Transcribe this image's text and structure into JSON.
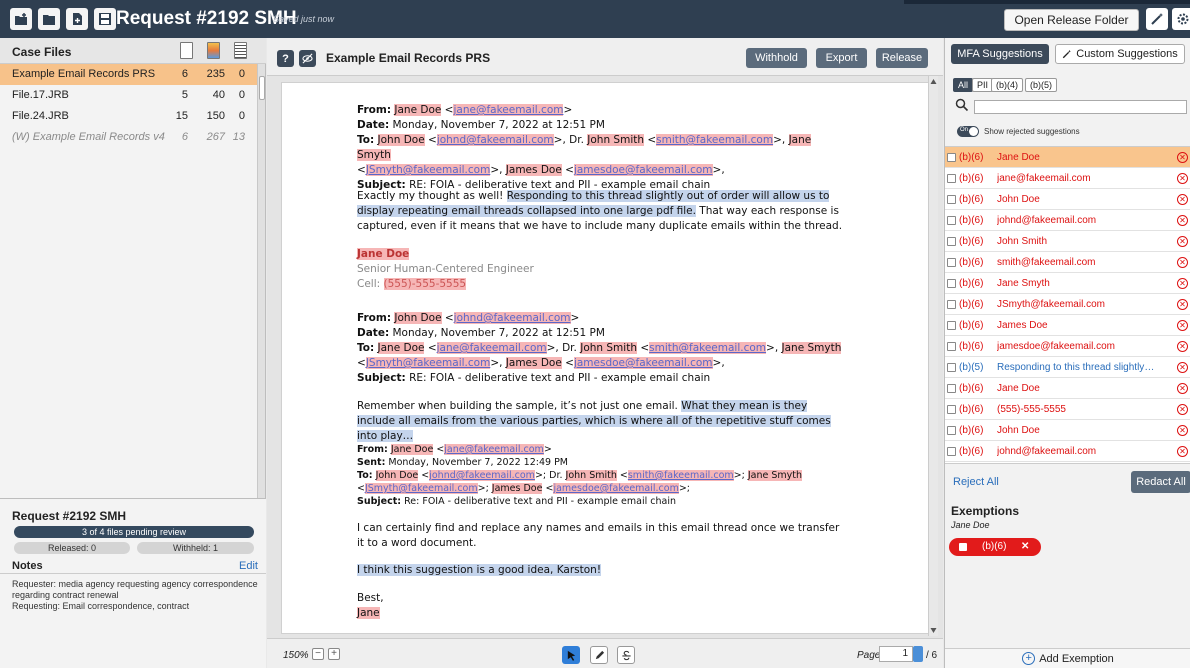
{
  "app": {
    "title": "Request #2192 SMH",
    "saved_status": "Saved just now",
    "open_folder_label": "Open Release Folder"
  },
  "case_files": {
    "title": "Case Files",
    "rows": [
      {
        "name": "Example Email Records PRS",
        "a": "6",
        "b": "235",
        "c": "0"
      },
      {
        "name": "File.17.JRB",
        "a": "5",
        "b": "40",
        "c": "0"
      },
      {
        "name": "File.24.JRB",
        "a": "15",
        "b": "150",
        "c": "0"
      },
      {
        "name": "(W) Example Email Records v4",
        "a": "6",
        "b": "267",
        "c": "13"
      }
    ]
  },
  "request": {
    "title": "Request #2192 SMH",
    "pending": "3 of 4 files pending review",
    "released": "Released: 0",
    "withheld": "Withheld: 1",
    "notes_label": "Notes",
    "edit_label": "Edit",
    "notes_line1": "Requester: media agency requesting agency correspondence regarding contract renewal",
    "notes_line2": "Requesting: Email correspondence, contract"
  },
  "document": {
    "title": "Example Email Records PRS",
    "withhold_label": "Withhold",
    "export_label": "Export",
    "release_label": "Release",
    "zoom": "150%",
    "page_label": "Page:",
    "page_value": "1",
    "page_total": "/ 6"
  },
  "email": {
    "from_lbl": "From:",
    "date_lbl": "Date:",
    "to_lbl": "To:",
    "subject_lbl": "Subject:",
    "sent_lbl": "Sent:",
    "jane_doe": "Jane Doe",
    "jane_email": "jane@fakeemail.com",
    "john_doe": "John Doe",
    "john_email": "johnd@fakeemail.com",
    "john_smith": "John Smith",
    "smith_email": "smith@fakeemail.com",
    "jane_smyth": "Jane Smyth",
    "smyth_email": "JSmyth@fakeemail.com",
    "james_doe": "James Doe",
    "james_email": "jamesdoe@fakeemail.com",
    "date1": "Monday, November 7, 2022 at 12:51 PM",
    "date3": "Monday, November 7, 2022 12:49 PM",
    "subject": "RE: FOIA - deliberative text and PII - example email chain",
    "subject3": "Re: FOIA - deliberative text and PII - example email chain",
    "body1_a": "Exactly my thought as well! ",
    "body1_hl": "Responding to this thread slightly out of order will allow us to display repeating email threads collapsed into one large pdf file.",
    "body1_b": " That way each response is captured, even if it means that we have to include many duplicate emails within the thread.",
    "sig_title": "Senior Human-Centered Engineer",
    "sig_cell": "Cell: ",
    "sig_phone": "(555)-555-5555",
    "body2_a": "Remember when building the sample, it’s not just one email.  ",
    "body2_hl": "What they mean is they include all emails from the various parties, which is where all of the repetitive stuff comes into play…",
    "body3": "I can certainly find and replace any names and emails in this email thread once we transfer it to a word document.",
    "body3_hl": "I think this suggestion is a good idea, Karston!",
    "best": "Best,",
    "jane": "Jane",
    "dr": "Dr. "
  },
  "suggestions": {
    "mfa_tab": "MFA Suggestions",
    "custom_tab": "Custom Suggestions",
    "filters": [
      "All",
      "PII",
      "(b)(4)",
      "(b)(5)"
    ],
    "search_placeholder": "",
    "toggle_on": "On",
    "show_rejected": "Show rejected suggestions",
    "items": [
      {
        "code": "(b)(6)",
        "value": "Jane Doe"
      },
      {
        "code": "(b)(6)",
        "value": "jane@fakeemail.com"
      },
      {
        "code": "(b)(6)",
        "value": "John Doe"
      },
      {
        "code": "(b)(6)",
        "value": "johnd@fakeemail.com"
      },
      {
        "code": "(b)(6)",
        "value": "John Smith"
      },
      {
        "code": "(b)(6)",
        "value": "smith@fakeemail.com"
      },
      {
        "code": "(b)(6)",
        "value": "Jane Smyth"
      },
      {
        "code": "(b)(6)",
        "value": "JSmyth@fakeemail.com"
      },
      {
        "code": "(b)(6)",
        "value": "James Doe"
      },
      {
        "code": "(b)(6)",
        "value": "jamesdoe@fakeemail.com"
      },
      {
        "code": "(b)(5)",
        "value": "Responding to this thread slightly out ..."
      },
      {
        "code": "(b)(6)",
        "value": "Jane Doe"
      },
      {
        "code": "(b)(6)",
        "value": "(555)-555-5555"
      },
      {
        "code": "(b)(6)",
        "value": "John Doe"
      },
      {
        "code": "(b)(6)",
        "value": "johnd@fakeemail.com"
      }
    ],
    "reject_all": "Reject All",
    "redact_all": "Redact All"
  },
  "exemptions": {
    "title": "Exemptions",
    "subject": "Jane Doe",
    "chip_code": "(b)(6)",
    "add_label": "Add Exemption"
  },
  "colors": {
    "topbar": "#2f3f51",
    "selected_row": "#f7c28a",
    "redaction": "#f6b6b6",
    "deliberative_highlight": "#c4d4ec",
    "exemption_chip": "#e21b1b"
  }
}
